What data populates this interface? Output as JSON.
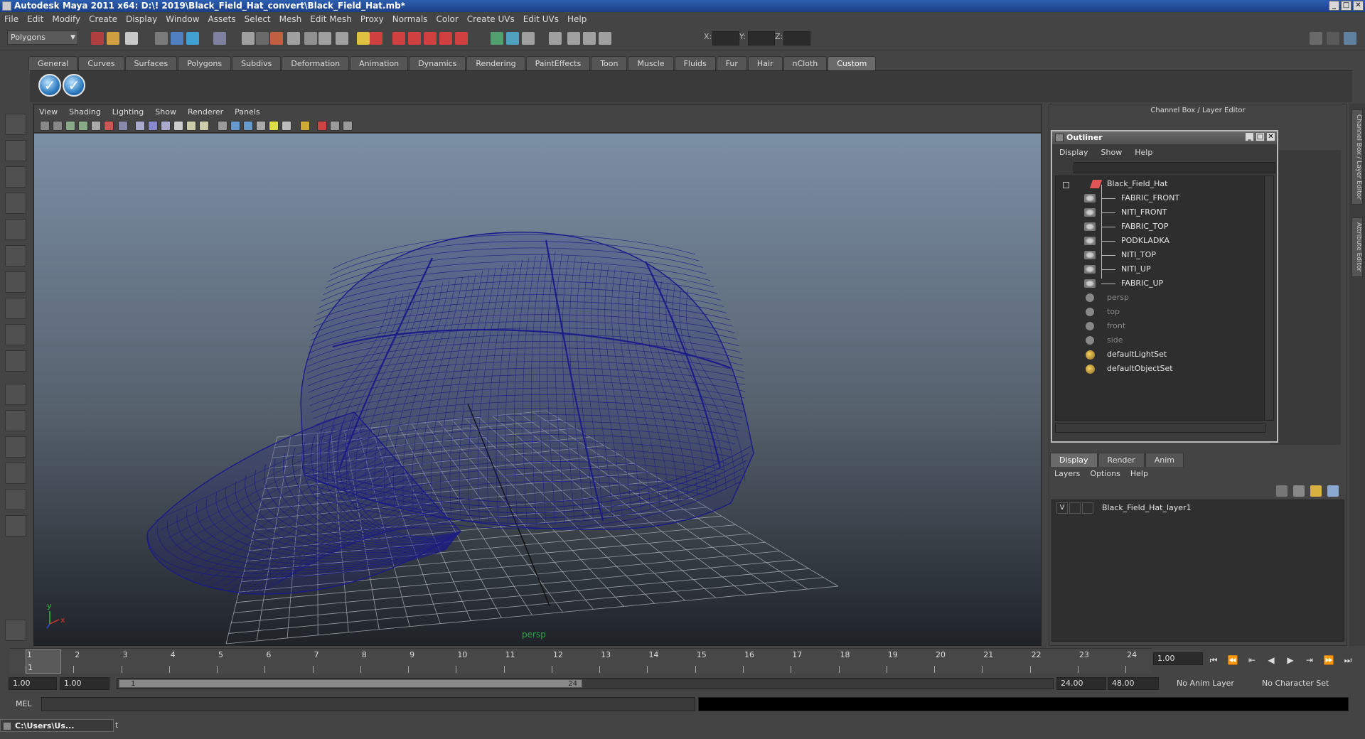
{
  "window": {
    "title": "Autodesk Maya 2011 x64: D:\\! 2019\\Black_Field_Hat_convert\\Black_Field_Hat.mb*"
  },
  "menubar": [
    "File",
    "Edit",
    "Modify",
    "Create",
    "Display",
    "Window",
    "Assets",
    "Select",
    "Mesh",
    "Edit Mesh",
    "Proxy",
    "Normals",
    "Color",
    "Create UVs",
    "Edit UVs",
    "Help"
  ],
  "status": {
    "mode": "Polygons",
    "x_label": "X:",
    "y_label": "Y:",
    "z_label": "Z:"
  },
  "shelf": {
    "tabs": [
      "General",
      "Curves",
      "Surfaces",
      "Polygons",
      "Subdivs",
      "Deformation",
      "Animation",
      "Dynamics",
      "Rendering",
      "PaintEffects",
      "Toon",
      "Muscle",
      "Fluids",
      "Fur",
      "Hair",
      "nCloth",
      "Custom"
    ],
    "active": "Custom"
  },
  "viewport": {
    "menu": [
      "View",
      "Shading",
      "Lighting",
      "Show",
      "Renderer",
      "Panels"
    ],
    "camera_label": "persp",
    "axis_y": "y",
    "axis_x": "x",
    "wire_color": "#1a1a8a"
  },
  "right_panel": {
    "title": "Channel Box / Layer Editor",
    "vtab1": "Channel Box / Layer Editor",
    "vtab2": "Attribute Editor"
  },
  "outliner": {
    "title": "Outliner",
    "menu": [
      "Display",
      "Show",
      "Help"
    ],
    "items": [
      {
        "label": "Black_Field_Hat",
        "kind": "group",
        "indent": 0
      },
      {
        "label": "FABRIC_FRONT",
        "kind": "mesh",
        "indent": 1
      },
      {
        "label": "NITI_FRONT",
        "kind": "mesh",
        "indent": 1
      },
      {
        "label": "FABRIC_TOP",
        "kind": "mesh",
        "indent": 1
      },
      {
        "label": "PODKLADKA",
        "kind": "mesh",
        "indent": 1
      },
      {
        "label": "NITI_TOP",
        "kind": "mesh",
        "indent": 1
      },
      {
        "label": "NITI_UP",
        "kind": "mesh",
        "indent": 1
      },
      {
        "label": "FABRIC_UP",
        "kind": "mesh",
        "indent": 1
      },
      {
        "label": "persp",
        "kind": "camera",
        "indent": 0
      },
      {
        "label": "top",
        "kind": "camera",
        "indent": 0
      },
      {
        "label": "front",
        "kind": "camera",
        "indent": 0
      },
      {
        "label": "side",
        "kind": "camera",
        "indent": 0
      },
      {
        "label": "defaultLightSet",
        "kind": "set",
        "indent": 0
      },
      {
        "label": "defaultObjectSet",
        "kind": "set",
        "indent": 0
      }
    ]
  },
  "layers": {
    "tabs": [
      "Display",
      "Render",
      "Anim"
    ],
    "active": "Display",
    "menu": [
      "Layers",
      "Options",
      "Help"
    ],
    "items": [
      {
        "visible": "V",
        "name": "Black_Field_Hat_layer1"
      }
    ]
  },
  "time": {
    "ticks": [
      "1",
      "2",
      "3",
      "4",
      "5",
      "6",
      "7",
      "8",
      "9",
      "10",
      "11",
      "12",
      "13",
      "14",
      "15",
      "16",
      "17",
      "18",
      "19",
      "20",
      "21",
      "22",
      "23",
      "24"
    ],
    "current_frame": "1",
    "current_field": "1.00",
    "range_start": "1.00",
    "range_start2": "1.00",
    "range_inner_start": "1",
    "range_inner_end": "24",
    "range_end": "24.00",
    "range_end2": "48.00",
    "anim_layer": "No Anim Layer",
    "char_set": "No Character Set"
  },
  "command": {
    "label": "MEL"
  },
  "taskbar": {
    "label": "C:\\Users\\Us...",
    "help_fragment": "t"
  }
}
